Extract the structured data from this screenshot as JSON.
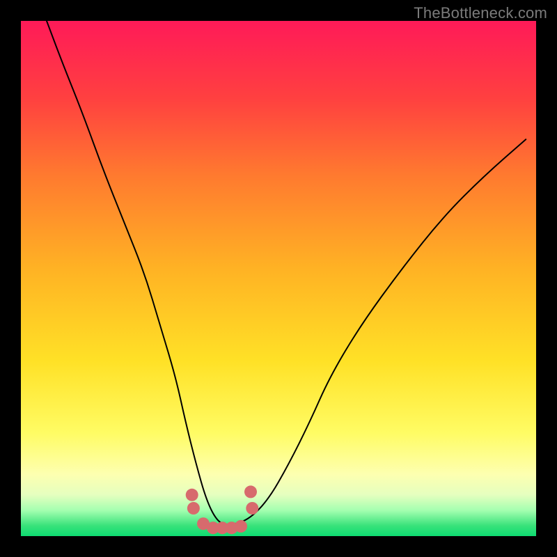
{
  "watermark": "TheBottleneck.com",
  "chart_data": {
    "type": "line",
    "title": "",
    "xlabel": "",
    "ylabel": "",
    "xlim": [
      0,
      100
    ],
    "ylim": [
      0,
      100
    ],
    "series": [
      {
        "name": "bottleneck-curve",
        "x": [
          5,
          8,
          12,
          16,
          20,
          24,
          27,
          30,
          32,
          34,
          36,
          38,
          40,
          44,
          48,
          52,
          56,
          60,
          66,
          74,
          82,
          90,
          98
        ],
        "y": [
          100,
          92,
          82,
          71,
          61,
          51,
          41,
          31,
          22,
          14,
          7,
          3,
          2,
          3,
          7,
          14,
          22,
          31,
          41,
          52,
          62,
          70,
          77
        ]
      }
    ],
    "highlight_points": {
      "name": "marked-range",
      "x": [
        33.2,
        33.5,
        35.4,
        37.3,
        39.1,
        40.9,
        42.7,
        44.9,
        44.6
      ],
      "y": [
        8.0,
        5.4,
        2.4,
        1.6,
        1.6,
        1.6,
        1.9,
        5.4,
        8.6
      ]
    },
    "gradient_stops": [
      {
        "pos": 0,
        "color": "#ff1a58"
      },
      {
        "pos": 15,
        "color": "#ff4040"
      },
      {
        "pos": 30,
        "color": "#ff7a2f"
      },
      {
        "pos": 48,
        "color": "#ffb224"
      },
      {
        "pos": 66,
        "color": "#ffe126"
      },
      {
        "pos": 80,
        "color": "#fffc64"
      },
      {
        "pos": 88,
        "color": "#fdffb0"
      },
      {
        "pos": 92,
        "color": "#e5ffbf"
      },
      {
        "pos": 95,
        "color": "#a4ffb0"
      },
      {
        "pos": 98,
        "color": "#38e27a"
      },
      {
        "pos": 100,
        "color": "#0edc72"
      }
    ]
  }
}
